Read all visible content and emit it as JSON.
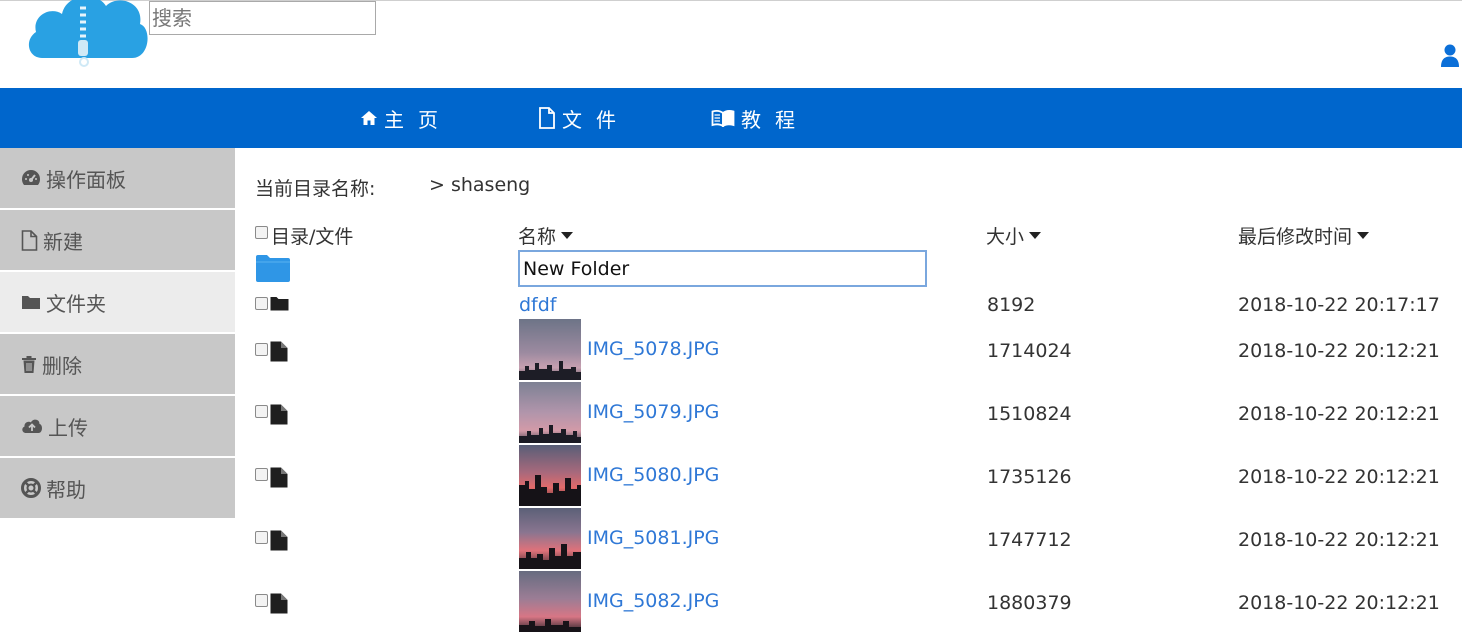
{
  "search": {
    "placeholder": "搜索"
  },
  "nav": [
    {
      "label": "主页",
      "icon": "home-icon"
    },
    {
      "label": "文件",
      "icon": "file-icon"
    },
    {
      "label": "教程",
      "icon": "book-icon"
    }
  ],
  "sidebar": [
    {
      "label": "操作面板",
      "icon": "dashboard-icon",
      "active": false
    },
    {
      "label": "新建",
      "icon": "new-file-icon",
      "active": false
    },
    {
      "label": "文件夹",
      "icon": "folder-icon",
      "active": true
    },
    {
      "label": "删除",
      "icon": "trash-icon",
      "active": false
    },
    {
      "label": "上传",
      "icon": "cloud-upload-icon",
      "active": false
    },
    {
      "label": "帮助",
      "icon": "help-icon",
      "active": false
    }
  ],
  "breadcrumb": {
    "label": "当前目录名称:",
    "path": "> shaseng"
  },
  "table": {
    "headers": {
      "select": "目录/文件",
      "name": "名称",
      "size": "大小",
      "modified": "最后修改时间"
    },
    "new_folder_value": "New Folder",
    "rows": [
      {
        "type": "folder",
        "name": "dfdf",
        "size": "8192",
        "modified": "2018-10-22 20:17:17"
      },
      {
        "type": "file",
        "name": "IMG_5078.JPG",
        "size": "1714024",
        "modified": "2018-10-22 20:12:21"
      },
      {
        "type": "file",
        "name": "IMG_5079.JPG",
        "size": "1510824",
        "modified": "2018-10-22 20:12:21"
      },
      {
        "type": "file",
        "name": "IMG_5080.JPG",
        "size": "1735126",
        "modified": "2018-10-22 20:12:21"
      },
      {
        "type": "file",
        "name": "IMG_5081.JPG",
        "size": "1747712",
        "modified": "2018-10-22 20:12:21"
      },
      {
        "type": "file",
        "name": "IMG_5082.JPG",
        "size": "1880379",
        "modified": "2018-10-22 20:12:21"
      }
    ]
  },
  "colors": {
    "nav_bg": "#0066cc",
    "link": "#2f78d6",
    "sidebar_bg": "#c8c8c8",
    "sidebar_active": "#ececec",
    "logo": "#29a1e3"
  }
}
